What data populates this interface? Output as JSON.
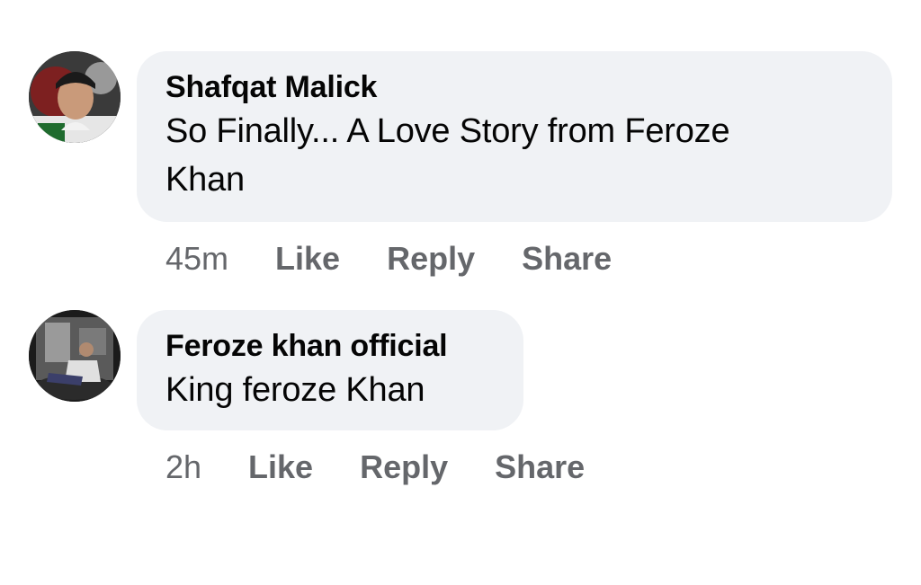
{
  "comments": [
    {
      "author": "Shafqat Malick",
      "text_lines": [
        "So Finally... A Love Story from Feroze",
        "Khan"
      ],
      "time": "45m",
      "actions": {
        "like": "Like",
        "reply": "Reply",
        "share": "Share"
      }
    },
    {
      "author": "Feroze khan official",
      "text_lines": [
        "King feroze Khan"
      ],
      "time": "2h",
      "actions": {
        "like": "Like",
        "reply": "Reply",
        "share": "Share"
      }
    }
  ],
  "colors": {
    "bubble_bg": "#f0f2f5",
    "author_text": "#050505",
    "action_text": "#65676b"
  }
}
